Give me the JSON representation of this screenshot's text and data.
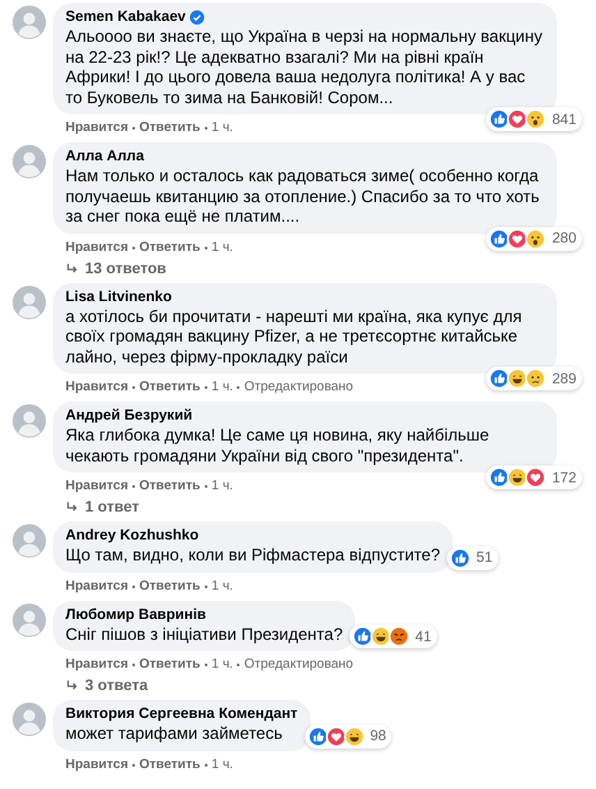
{
  "comments": [
    {
      "author": "Semen Kabakaev",
      "verified": true,
      "text": "Альоооо ви знаєте, що Україна в черзі на нормальну вакцину на 22-23 рік!? Це адекватно взагалі? Ми на рівні країн Африки! І до цього довела ваша недолуга політика! А у вас то Буковель то зима на Банковій! Сором...",
      "reactions": [
        {
          "kind": "like"
        },
        {
          "kind": "love"
        },
        {
          "kind": "wow"
        }
      ],
      "reaction_count": "841",
      "like": "Нравится",
      "reply": "Ответить",
      "time": "1 ч."
    },
    {
      "author": "Алла Алла",
      "verified": false,
      "text": "Нам только и осталось как радоваться зиме( особенно когда получаешь квитанцию за отопление.) Спасибо за то что хоть за снег пока ещё не платим....",
      "reactions": [
        {
          "kind": "like"
        },
        {
          "kind": "love"
        },
        {
          "kind": "wow"
        }
      ],
      "reaction_count": "280",
      "like": "Нравится",
      "reply": "Ответить",
      "time": "1 ч.",
      "replies": "13 ответов"
    },
    {
      "author": "Lisa Litvinenko",
      "verified": false,
      "text": "а хотілось би прочитати - нарешті ми країна, яка купує для своїх громадян вакцину Pfizer, а не третєсортнє китайське лайно, через фірму-прокладку раїси",
      "reactions": [
        {
          "kind": "like"
        },
        {
          "kind": "haha"
        },
        {
          "kind": "sad"
        }
      ],
      "reaction_count": "289",
      "like": "Нравится",
      "reply": "Ответить",
      "time": "1 ч.",
      "edited": "Отредактировано"
    },
    {
      "author": "Андрей Безрукий",
      "verified": false,
      "text": "Яка глибока думка! Це саме ця новина, яку найбільше чекають громадяни України від свого \"президента\".",
      "reactions": [
        {
          "kind": "like"
        },
        {
          "kind": "haha"
        },
        {
          "kind": "love"
        }
      ],
      "reaction_count": "172",
      "like": "Нравится",
      "reply": "Ответить",
      "time": "1 ч.",
      "replies": "1 ответ"
    },
    {
      "author": "Andrey Kozhushko",
      "verified": false,
      "text": "Що там, видно, коли ви Рiфмастера вiдпустите?",
      "reactions": [
        {
          "kind": "like"
        }
      ],
      "reaction_count": "51",
      "like": "Нравится",
      "reply": "Ответить",
      "time": "1 ч."
    },
    {
      "author": "Любомир Вавринів",
      "verified": false,
      "text": "Сніг пішов з ініціативи Президента?",
      "reactions": [
        {
          "kind": "like"
        },
        {
          "kind": "haha"
        },
        {
          "kind": "angry"
        }
      ],
      "reaction_count": "41",
      "like": "Нравится",
      "reply": "Ответить",
      "time": "1 ч.",
      "edited": "Отредактировано",
      "replies": "3 ответа"
    },
    {
      "author": "Виктория Сергеевна Комендант",
      "verified": false,
      "text": "может тарифами займетесь",
      "reactions": [
        {
          "kind": "like"
        },
        {
          "kind": "love"
        },
        {
          "kind": "haha"
        }
      ],
      "reaction_count": "98",
      "like": "Нравится",
      "reply": "Ответить",
      "time": "1 ч."
    }
  ]
}
